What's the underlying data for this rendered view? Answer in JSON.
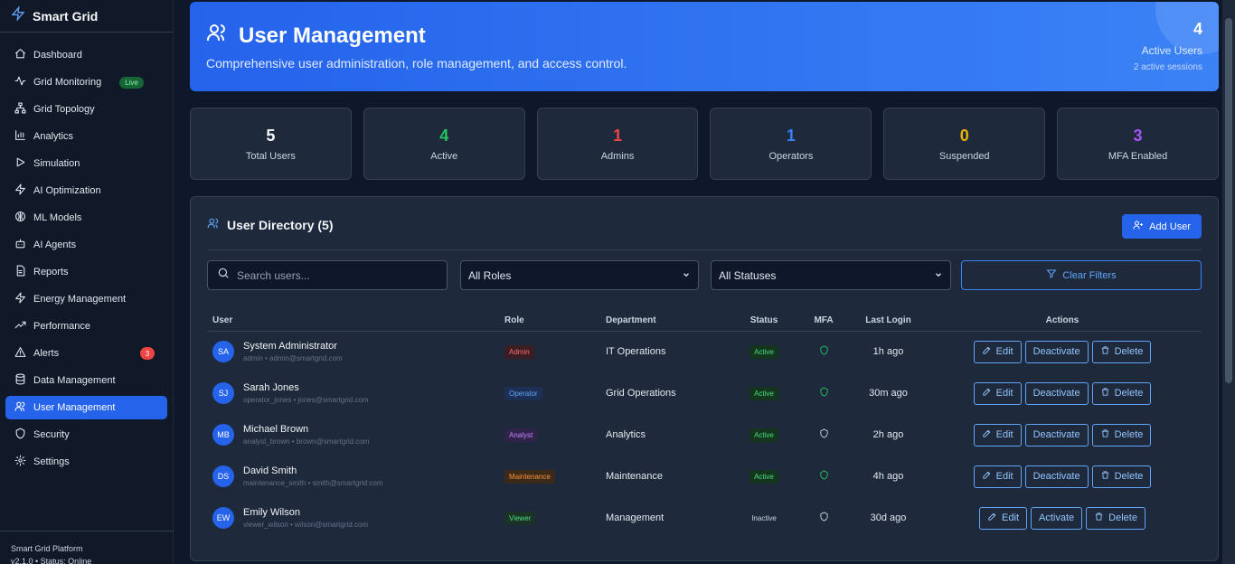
{
  "brand": {
    "name": "Smart Grid"
  },
  "sidebar": {
    "items": [
      {
        "label": "Dashboard",
        "icon": "home-icon"
      },
      {
        "label": "Grid Monitoring",
        "icon": "activity-icon",
        "badge": "Live"
      },
      {
        "label": "Grid Topology",
        "icon": "network-icon"
      },
      {
        "label": "Analytics",
        "icon": "bar-chart-icon"
      },
      {
        "label": "Simulation",
        "icon": "play-icon"
      },
      {
        "label": "AI Optimization",
        "icon": "zap-icon"
      },
      {
        "label": "ML Models",
        "icon": "brain-icon"
      },
      {
        "label": "AI Agents",
        "icon": "bot-icon"
      },
      {
        "label": "Reports",
        "icon": "file-icon"
      },
      {
        "label": "Energy Management",
        "icon": "bolt-icon"
      },
      {
        "label": "Performance",
        "icon": "trending-icon"
      },
      {
        "label": "Alerts",
        "icon": "alert-icon",
        "count": "3"
      },
      {
        "label": "Data Management",
        "icon": "database-icon"
      },
      {
        "label": "User Management",
        "icon": "users-icon",
        "active": true
      },
      {
        "label": "Security",
        "icon": "shield-icon"
      },
      {
        "label": "Settings",
        "icon": "gear-icon"
      }
    ],
    "footer": {
      "line1": "Smart Grid Platform",
      "line2": "v2.1.0 • Status: Online"
    }
  },
  "hero": {
    "title": "User Management",
    "subtitle": "Comprehensive user administration, role management, and access control.",
    "active_count": "4",
    "active_label": "Active Users",
    "sessions": "2 active sessions"
  },
  "stats": [
    {
      "value": "5",
      "label": "Total Users",
      "color": "#f8fafc"
    },
    {
      "value": "4",
      "label": "Active",
      "color": "#22c55e"
    },
    {
      "value": "1",
      "label": "Admins",
      "color": "#ef4444"
    },
    {
      "value": "1",
      "label": "Operators",
      "color": "#3b82f6"
    },
    {
      "value": "0",
      "label": "Suspended",
      "color": "#eab308"
    },
    {
      "value": "3",
      "label": "MFA Enabled",
      "color": "#a855f7"
    }
  ],
  "directory": {
    "title": "User Directory (5)",
    "add_label": "Add User",
    "search_placeholder": "Search users...",
    "role_filter": "All Roles",
    "status_filter": "All Statuses",
    "clear_label": "Clear Filters",
    "columns": [
      "User",
      "Role",
      "Department",
      "Status",
      "MFA",
      "Last Login",
      "Actions"
    ],
    "rows": [
      {
        "initials": "SA",
        "name": "System Administrator",
        "meta": "admin • admin@smartgrid.com",
        "role": "Admin",
        "dept": "IT Operations",
        "status": "Active",
        "mfa": true,
        "last": "1h ago",
        "toggle": "Deactivate"
      },
      {
        "initials": "SJ",
        "name": "Sarah Jones",
        "meta": "operator_jones • jones@smartgrid.com",
        "role": "Operator",
        "dept": "Grid Operations",
        "status": "Active",
        "mfa": true,
        "last": "30m ago",
        "toggle": "Deactivate"
      },
      {
        "initials": "MB",
        "name": "Michael Brown",
        "meta": "analyst_brown • brown@smartgrid.com",
        "role": "Analyst",
        "dept": "Analytics",
        "status": "Active",
        "mfa": false,
        "last": "2h ago",
        "toggle": "Deactivate"
      },
      {
        "initials": "DS",
        "name": "David Smith",
        "meta": "maintenance_smith • smith@smartgrid.com",
        "role": "Maintenance",
        "dept": "Maintenance",
        "status": "Active",
        "mfa": true,
        "last": "4h ago",
        "toggle": "Deactivate"
      },
      {
        "initials": "EW",
        "name": "Emily Wilson",
        "meta": "viewer_wilson • wilson@smartgrid.com",
        "role": "Viewer",
        "dept": "Management",
        "status": "Inactive",
        "mfa": false,
        "last": "30d ago",
        "toggle": "Activate"
      }
    ],
    "edit_label": "Edit",
    "delete_label": "Delete"
  },
  "role_colors": {
    "Admin": {
      "bg": "#3b1d24",
      "fg": "#f87171"
    },
    "Operator": {
      "bg": "#1e2f55",
      "fg": "#60a5fa"
    },
    "Analyst": {
      "bg": "#2f2348",
      "fg": "#c084fc"
    },
    "Maintenance": {
      "bg": "#3b2a1a",
      "fg": "#fb923c"
    },
    "Viewer": {
      "bg": "#1a3326",
      "fg": "#4ade80"
    }
  }
}
